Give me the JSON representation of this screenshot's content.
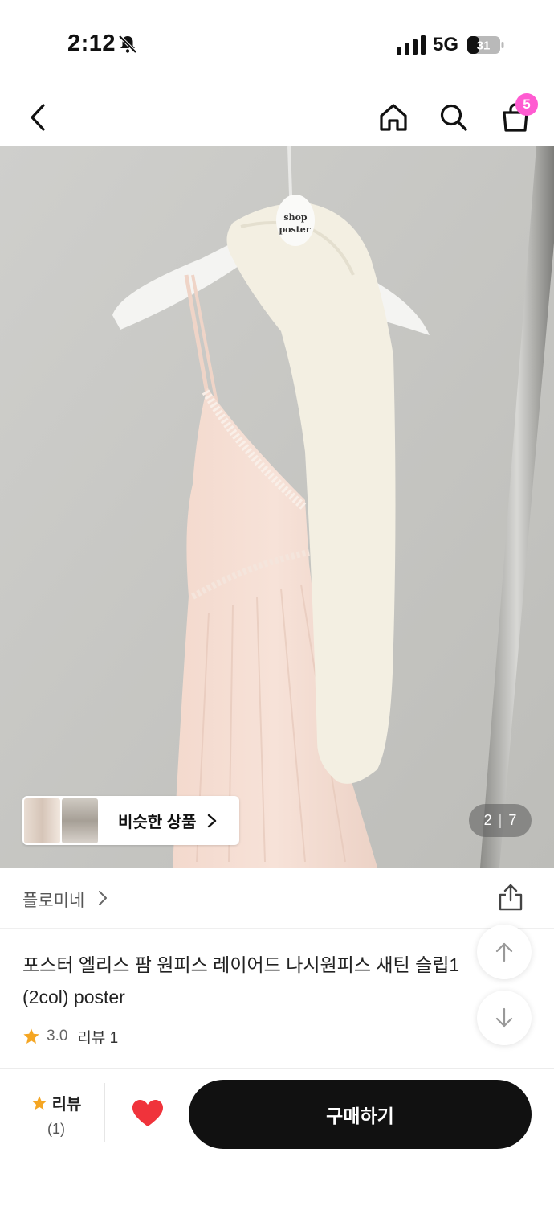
{
  "status_bar": {
    "time": "2:12",
    "network": "5G",
    "battery": "31"
  },
  "nav": {
    "cart_count": "5"
  },
  "hero": {
    "similar_label": "비슷한 상품",
    "counter_current": "2",
    "counter_sep": "|",
    "counter_total": "7",
    "hanger_tag": "shop poster"
  },
  "brand": {
    "name": "플로미네"
  },
  "product": {
    "title": "포스터 엘리스 팜 원피스 레이어드 나시원피스 새틴 슬립1 (2col) poster",
    "rating": "3.0",
    "review_link": "리뷰 1"
  },
  "bottom": {
    "review_label": "리뷰",
    "review_count": "(1)",
    "buy_label": "구매하기"
  },
  "colors": {
    "badge": "#ff5bd1",
    "heart": "#f0333b",
    "star": "#f5a623",
    "button": "#111111"
  }
}
